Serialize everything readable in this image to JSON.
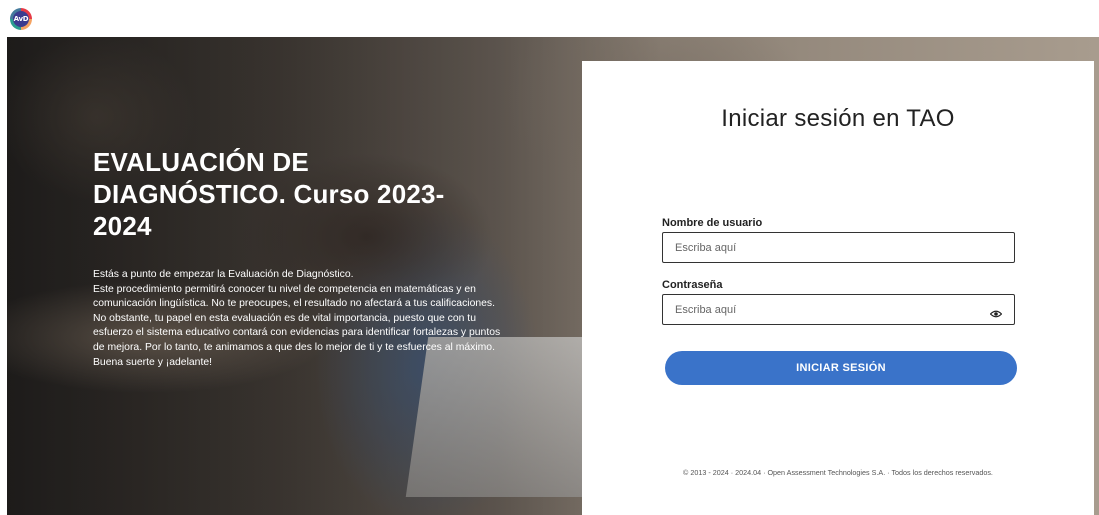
{
  "header": {
    "logo_text": "AvD"
  },
  "hero": {
    "title": "EVALUACIÓN DE DIAGNÓSTICO. Curso 2023-2024",
    "paragraphs": [
      "Estás a punto de empezar la Evaluación de Diagnóstico.",
      "Este procedimiento permitirá conocer tu nivel de competencia en matemáticas y en comunicación lingüística. No te preocupes, el resultado no afectará a tus calificaciones.",
      "No obstante, tu papel en esta evaluación es de vital importancia, puesto que con tu esfuerzo el sistema educativo contará con evidencias para identificar fortalezas y puntos de mejora. Por lo tanto, te animamos a que des lo mejor de ti y te esfuerces al máximo.",
      "Buena suerte y ¡adelante!"
    ]
  },
  "login": {
    "title": "Iniciar sesión en TAO",
    "username_label": "Nombre de usuario",
    "username_placeholder": "Escriba aquí",
    "username_value": "",
    "password_label": "Contraseña",
    "password_placeholder": "Escriba aquí",
    "password_value": "",
    "submit_label": "INICIAR SESIÓN",
    "footer": "© 2013 - 2024 · 2024.04 · Open Assessment Technologies S.A. · Todos los derechos reservados.",
    "accent_color": "#3a73c9"
  },
  "icons": {
    "logo": "avd-logo-icon",
    "password_toggle": "eye-icon"
  }
}
